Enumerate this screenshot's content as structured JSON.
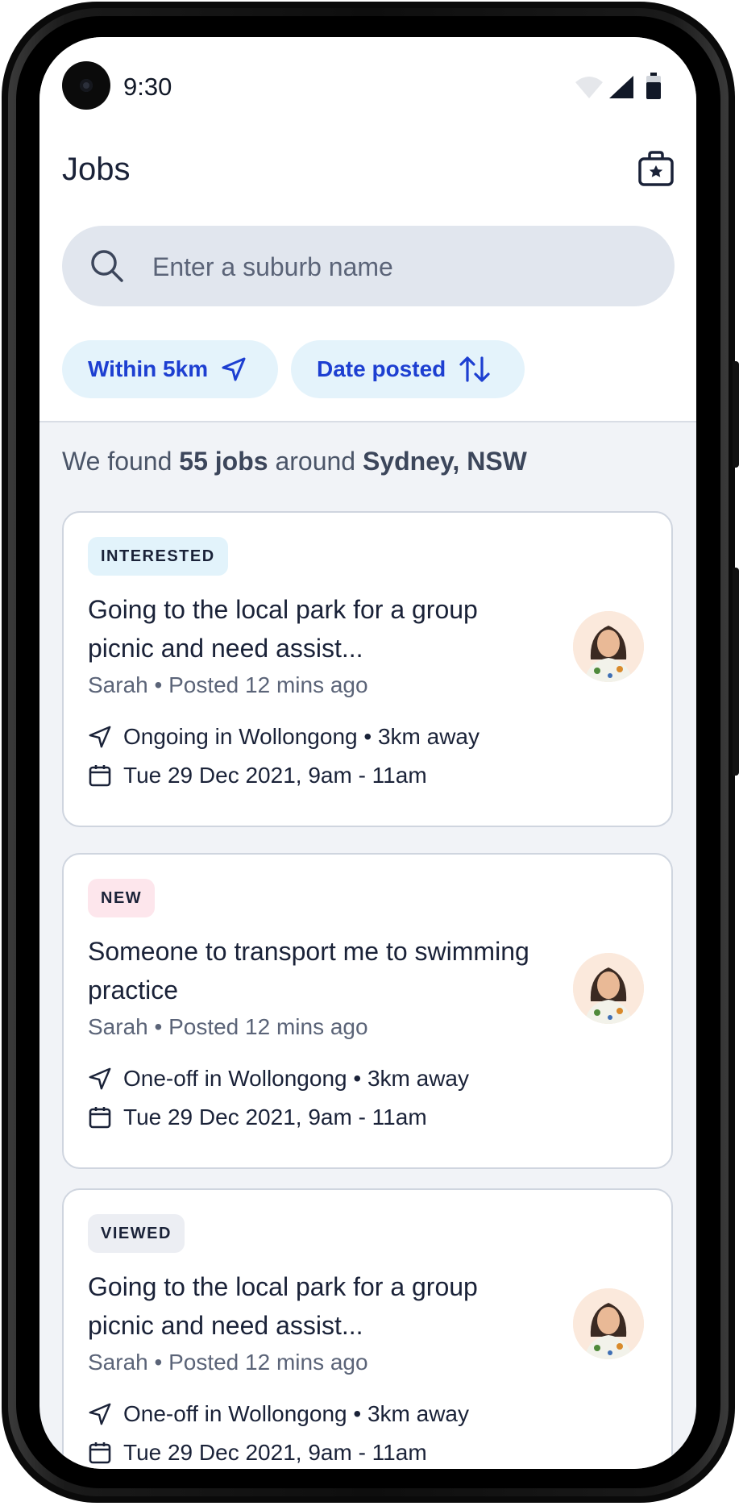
{
  "status_bar": {
    "time": "9:30"
  },
  "header": {
    "title": "Jobs"
  },
  "search": {
    "placeholder": "Enter a suburb name"
  },
  "filters": [
    {
      "label": "Within 5km",
      "icon": "navigation-arrow-icon"
    },
    {
      "label": "Date posted",
      "icon": "sort-arrows-icon"
    }
  ],
  "results": {
    "prefix": "We found ",
    "count": "55 jobs",
    "middle": " around ",
    "location": "Sydney, NSW"
  },
  "jobs": [
    {
      "badge": "INTERESTED",
      "title": "Going to the local park for a group picnic and need assist...",
      "meta": "Sarah • Posted 12 mins ago",
      "location": "Ongoing in Wollongong • 3km away",
      "date": "Tue 29 Dec 2021, 9am - 11am"
    },
    {
      "badge": "NEW",
      "title": "Someone to transport me to swimming practice",
      "meta": "Sarah • Posted 12 mins ago",
      "location": "One-off in Wollongong • 3km away",
      "date": "Tue 29 Dec 2021, 9am - 11am"
    },
    {
      "badge": "VIEWED",
      "title": "Going to the local park for a group picnic and need assist...",
      "meta": "Sarah • Posted 12 mins ago",
      "location": "One-off in Wollongong • 3km away",
      "date": "Tue 29 Dec 2021, 9am - 11am"
    }
  ],
  "colors": {
    "accent": "#1d3fd1",
    "chip_bg": "#e4f3fb",
    "page_bg": "#f1f3f7",
    "text": "#1a2238"
  }
}
